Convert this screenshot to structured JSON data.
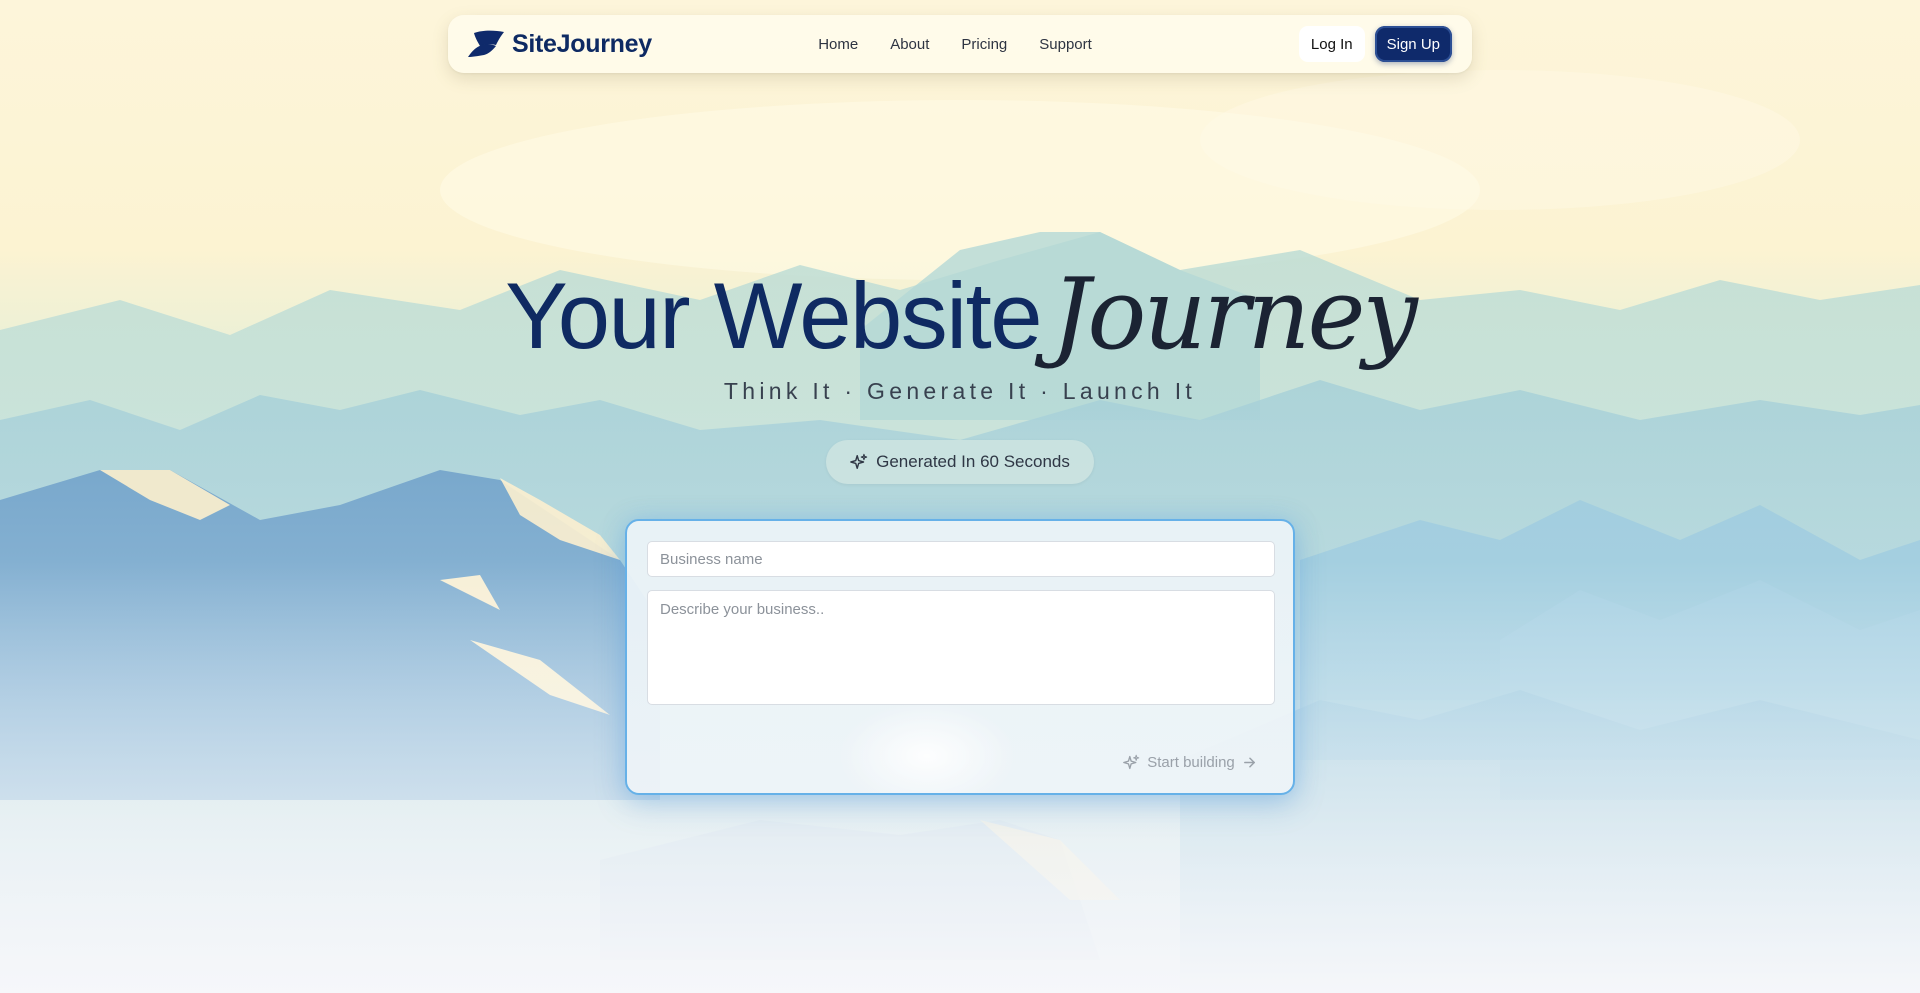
{
  "brand": {
    "name": "SiteJourney",
    "logo_icon": "leaf-swoosh-icon",
    "color": "#0e2a63"
  },
  "nav": {
    "links": [
      {
        "label": "Home"
      },
      {
        "label": "About"
      },
      {
        "label": "Pricing"
      },
      {
        "label": "Support"
      }
    ],
    "login_label": "Log In",
    "signup_label": "Sign Up"
  },
  "hero": {
    "title_main": "Your Website",
    "title_accent": "Journey",
    "subtitle": "Think It · Generate It · Launch It",
    "badge": {
      "icon": "sparkles-icon",
      "label": "Generated In 60 Seconds"
    }
  },
  "form": {
    "business_name": {
      "value": "",
      "placeholder": "Business name"
    },
    "description": {
      "value": "",
      "placeholder": "Describe your business.."
    },
    "submit": {
      "icon": "sparkles-icon",
      "label": "Start building",
      "trailing_icon": "arrow-right-icon"
    }
  },
  "colors": {
    "primary_navy": "#0f2a6b",
    "card_border": "#66b1e8",
    "sky_top": "#fdf6dc",
    "mountain_blue": "#7fb0d3"
  }
}
